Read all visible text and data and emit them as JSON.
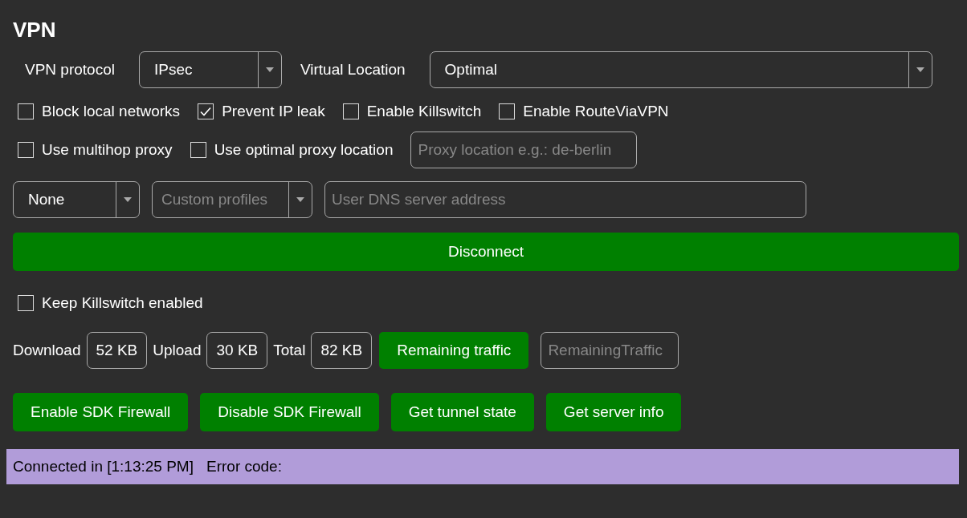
{
  "title": "VPN",
  "protocol": {
    "label": "VPN protocol",
    "value": "IPsec"
  },
  "location": {
    "label": "Virtual Location",
    "value": "Optimal"
  },
  "options_row1": [
    {
      "label": "Block local networks",
      "checked": false
    },
    {
      "label": "Prevent IP leak",
      "checked": true
    },
    {
      "label": "Enable Killswitch",
      "checked": false
    },
    {
      "label": "Enable RouteViaVPN",
      "checked": false
    }
  ],
  "options_row2": [
    {
      "label": "Use multihop proxy",
      "checked": false
    },
    {
      "label": "Use optimal proxy location",
      "checked": false
    }
  ],
  "proxy_location": {
    "placeholder": "Proxy location e.g.: de-berlin"
  },
  "dns_dropdown": {
    "value": "None"
  },
  "profiles_dropdown": {
    "placeholder": "Custom profiles"
  },
  "dns_server": {
    "placeholder": "User DNS server address"
  },
  "connect_button": "Disconnect",
  "keep_killswitch": {
    "label": "Keep Killswitch enabled",
    "checked": false
  },
  "traffic": [
    {
      "label": "Download",
      "value": "52 KB"
    },
    {
      "label": "Upload",
      "value": "30 KB"
    },
    {
      "label": "Total",
      "value": "82 KB"
    }
  ],
  "remaining_button": "Remaining traffic",
  "remaining_field": {
    "placeholder": "RemainingTraffic"
  },
  "actions": [
    "Enable SDK Firewall",
    "Disable SDK Firewall",
    "Get tunnel state",
    "Get server info"
  ],
  "status_bar": {
    "connection": "Connected in [1:13:25 PM]",
    "error": "Error code:"
  }
}
